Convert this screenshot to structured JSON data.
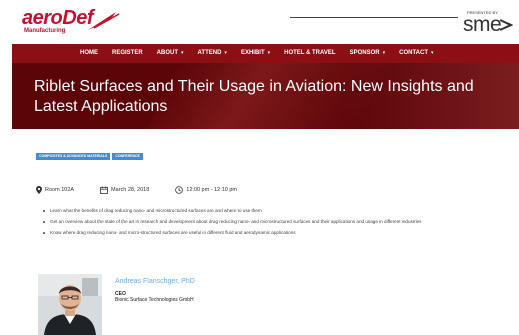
{
  "brand": {
    "logo_word": "aeroDef",
    "logo_sub": "Manufacturing",
    "partner_small": "PRESENTED BY",
    "partner_word": "sme"
  },
  "nav": {
    "items": [
      {
        "label": "HOME",
        "has_caret": false
      },
      {
        "label": "REGISTER",
        "has_caret": false
      },
      {
        "label": "ABOUT",
        "has_caret": true
      },
      {
        "label": "ATTEND",
        "has_caret": true
      },
      {
        "label": "EXHIBIT",
        "has_caret": true
      },
      {
        "label": "HOTEL & TRAVEL",
        "has_caret": false
      },
      {
        "label": "SPONSOR",
        "has_caret": true
      },
      {
        "label": "CONTACT",
        "has_caret": true
      }
    ],
    "caret_glyph": "▾"
  },
  "hero": {
    "title": "Riblet Surfaces and Their Usage in Aviation: New Insights and Latest Applications"
  },
  "tags": [
    "COMPOSITES & ADVANCED MATERIALS",
    "CONFERENCE"
  ],
  "meta": {
    "room": "Room 102A",
    "date": "March 28, 2018",
    "time": "12:00 pm - 12:10 pm"
  },
  "bullets": [
    "Learn what the benefits of drag reducing nano- and microstructured surfaces are and where to use them",
    "Get an overview about the state of the art in research and development about drag reducing nano- and microstructured surfaces and their applications and usage in different industries",
    "Know where drag reducing nano- and micro-structured surfaces are useful in different fluid and aerodynamic applications"
  ],
  "speaker": {
    "name": "Andreas Flanschger, PhD",
    "role": "CEO",
    "organization": "Bionic Surface Technologies GmbH"
  },
  "colors": {
    "nav_bg": "#8b0f14",
    "hero_bg": "#5c0508",
    "brand_red": "#c8102e",
    "tag_blue": "#3a8fd8",
    "speaker_link": "#6aaee8"
  }
}
